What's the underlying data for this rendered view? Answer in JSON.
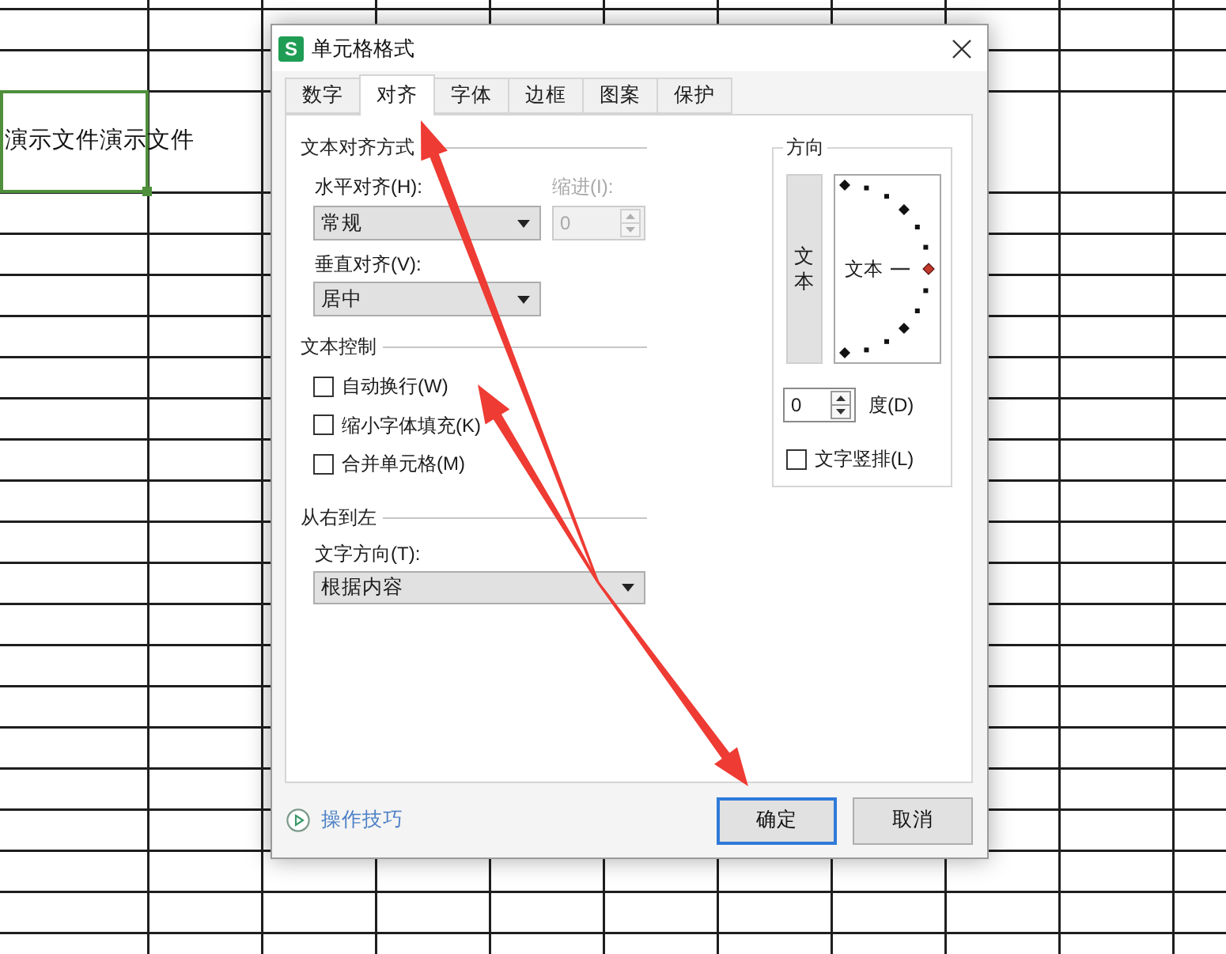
{
  "sheet": {
    "cell": {
      "text": "演示文件演示文件",
      "selected": true
    }
  },
  "dialog": {
    "logo_letter": "S",
    "title": "单元格格式"
  },
  "tabs": [
    {
      "label": "数字",
      "selected": false
    },
    {
      "label": "对齐",
      "selected": true
    },
    {
      "label": "字体",
      "selected": false
    },
    {
      "label": "边框",
      "selected": false
    },
    {
      "label": "图案",
      "selected": false
    },
    {
      "label": "保护",
      "selected": false
    }
  ],
  "text_alignment": {
    "title": "文本对齐方式",
    "horizontal": {
      "label": "水平对齐(H):",
      "value": "常规"
    },
    "indent": {
      "label": "缩进(I):",
      "value": "0",
      "disabled": true
    },
    "vertical": {
      "label": "垂直对齐(V):",
      "value": "居中"
    }
  },
  "text_control": {
    "title": "文本控制",
    "options": [
      {
        "label": "自动换行(W)",
        "checked": false
      },
      {
        "label": "缩小字体填充(K)",
        "checked": false
      },
      {
        "label": "合并单元格(M)",
        "checked": false
      }
    ]
  },
  "right_to_left": {
    "title": "从右到左",
    "direction": {
      "label": "文字方向(T):",
      "value": "根据内容"
    }
  },
  "orientation": {
    "title": "方向",
    "vertical_button": "文本",
    "dial_text": "文本",
    "degrees": {
      "value": "0",
      "label": "度(D)"
    },
    "vertical_stack": {
      "label": "文字竖排(L)",
      "checked": false
    }
  },
  "footer": {
    "tips_link": "操作技巧",
    "buttons": [
      {
        "label": "确定",
        "focused": true
      },
      {
        "label": "取消",
        "focused": false
      }
    ]
  }
}
